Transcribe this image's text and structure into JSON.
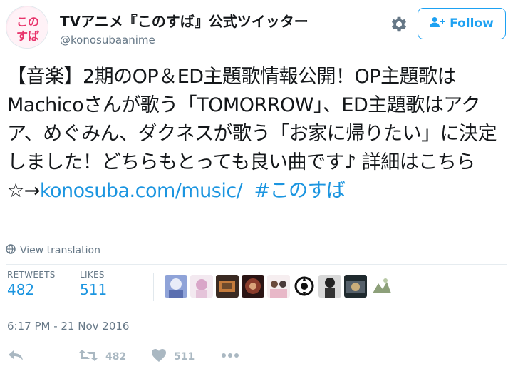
{
  "header": {
    "display_name": "TVアニメ『このすば』公式ツイッター",
    "username": "@konosubaanime",
    "avatar_text": "このすば",
    "follow_label": "Follow"
  },
  "tweet": {
    "text_main": "【音楽】2期のOP＆ED主題歌情報公開！OP主題歌はMachicoさんが歌う「TOMORROW」、ED主題歌はアクア、めぐみん、ダクネスが歌う「お家に帰りたい」に決定しました！どちらもとっても良い曲です♪ 詳細はこちら☆→",
    "link_text": "konosuba.com/music/",
    "hashtag": "#このすば",
    "translate_label": "View translation"
  },
  "stats": {
    "retweets_label": "RETWEETS",
    "retweets_count": "482",
    "likes_label": "LIKES",
    "likes_count": "511"
  },
  "timestamp": "6:17 PM - 21 Nov 2016",
  "actions": {
    "retweet_count": "482",
    "like_count": "511"
  },
  "colors": {
    "link": "#1b95e0",
    "muted": "#657786",
    "icon": "#aab8c2"
  }
}
